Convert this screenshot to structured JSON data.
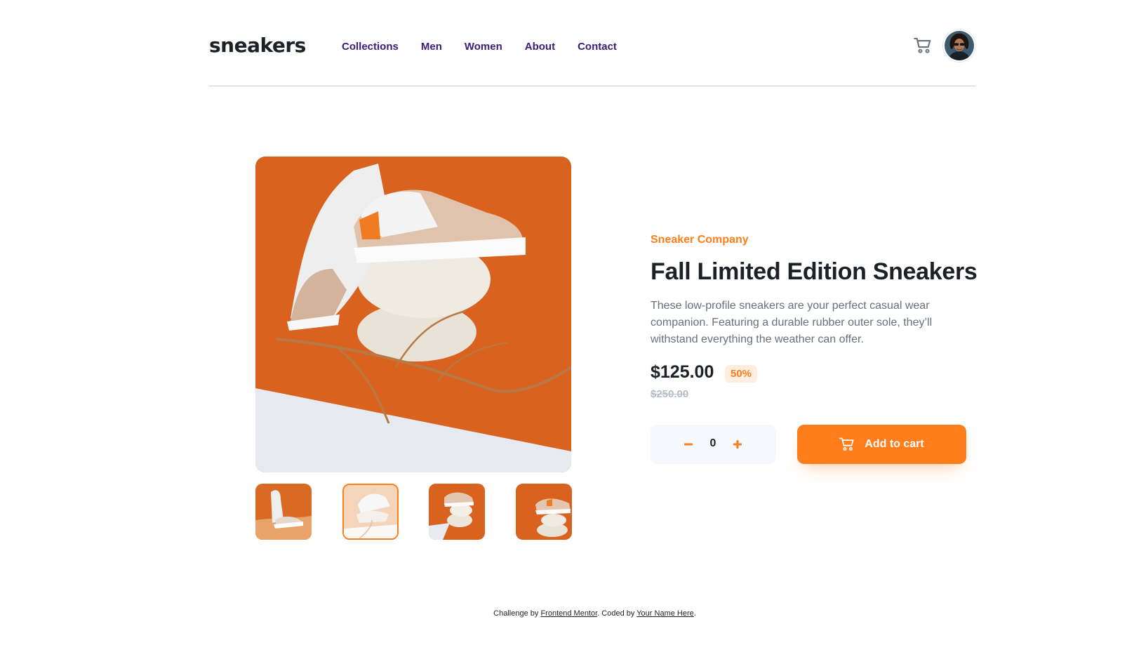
{
  "header": {
    "logo": "sneakers",
    "nav": [
      "Collections",
      "Men",
      "Women",
      "About",
      "Contact"
    ],
    "cart_icon": "cart-icon",
    "avatar_icon": "user-avatar"
  },
  "product": {
    "company": "Sneaker Company",
    "title": "Fall Limited Edition Sneakers",
    "description": "These low-profile sneakers are your perfect casual wear companion. Featuring a durable rubber outer sole, they’ll withstand everything the weather can offer.",
    "price": "$125.00",
    "discount": "50%",
    "old_price": "$250.00",
    "quantity": "0",
    "add_to_cart": "Add to cart"
  },
  "gallery": {
    "thumbnails": 4,
    "active_thumbnail": 2
  },
  "footer": {
    "prefix": "Challenge by ",
    "link1": "Frontend Mentor",
    "middle": ". Coded by ",
    "link2": "Your Name Here",
    "suffix": "."
  },
  "colors": {
    "accent": "#ff7d1a",
    "nav": "#3f1a78",
    "text_dark": "#1d2026",
    "text_gray": "#68707d"
  }
}
